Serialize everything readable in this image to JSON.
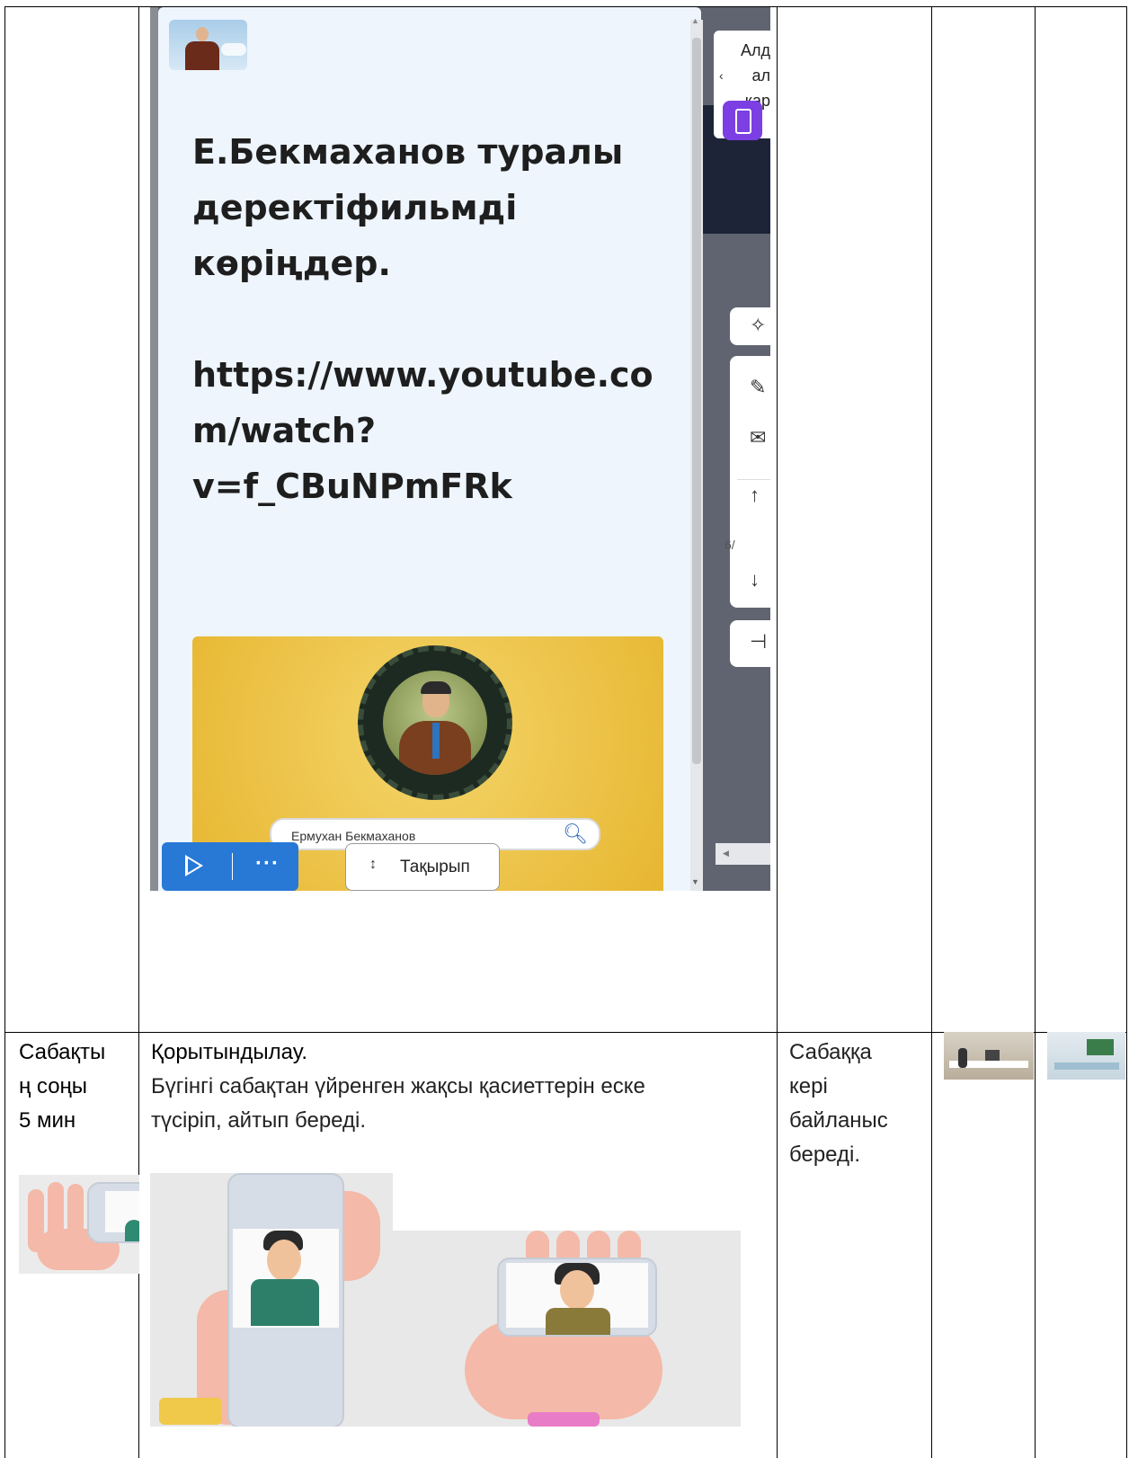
{
  "embedded_screenshot": {
    "slide_text": "Е.Бекмаханов туралы\nдеректіфильмді\nкөріңдер.\n\nhttps://www.youtube.co\nm/watch?\nv=f_CBuNPmFRk",
    "video_search_text": "Ермухан Бекмаханов",
    "play_button_label": "",
    "more_label": "···",
    "topic_button_label": "Тақырып",
    "side_popup_text": "Алд\nал\nкар",
    "page_indicator": "6/",
    "colors": {
      "accent_blue": "#2878d6",
      "purple": "#7b3fe4",
      "slide_bg": "#eef5fd",
      "video_bg": "#e7b630"
    }
  },
  "bottom_row": {
    "stage_label": "Сабақты\nң соңы\n5 мин",
    "title": "Қорытындылау.",
    "body": "Бүгінгі сабақтан үйренген жақсы қасиеттерін еске\nтүсіріп, айтып береді.",
    "feedback_text": "Сабаққа\nкері\nбайланыс\nбереді."
  }
}
